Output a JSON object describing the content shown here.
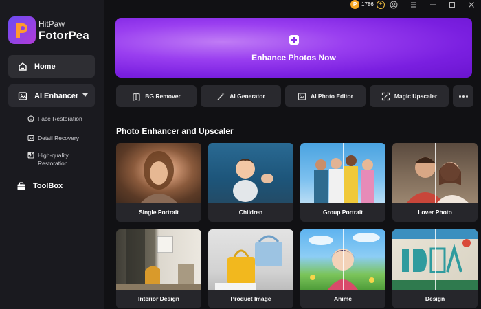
{
  "brand": {
    "small": "HitPaw",
    "big": "FotorPea"
  },
  "sidebar": {
    "home": "Home",
    "ai_enhancer": "AI Enhancer",
    "sub_items": [
      {
        "label": "Face Restoration",
        "icon": "face-icon"
      },
      {
        "label": "Detail Recovery",
        "icon": "detail-icon"
      },
      {
        "label": "High-quality Restoration",
        "icon": "restore-icon"
      }
    ],
    "toolbox": "ToolBox"
  },
  "titlebar": {
    "coins": "1786",
    "add": "+"
  },
  "hero": {
    "label": "Enhance Photos Now"
  },
  "tools": [
    {
      "label": "BG Remover",
      "icon": "bg-remover-icon"
    },
    {
      "label": "AI Generator",
      "icon": "ai-generator-icon"
    },
    {
      "label": "AI Photo Editor",
      "icon": "photo-editor-icon"
    },
    {
      "label": "Magic Upscaler",
      "icon": "upscaler-icon"
    }
  ],
  "section_title": "Photo Enhancer and Upscaler",
  "cards": [
    {
      "label": "Single Portrait"
    },
    {
      "label": "Children"
    },
    {
      "label": "Group Portrait"
    },
    {
      "label": "Lover Photo"
    },
    {
      "label": "Interior Design"
    },
    {
      "label": "Product Image"
    },
    {
      "label": "Anime"
    },
    {
      "label": "Design"
    }
  ],
  "colors": {
    "accent": "#8a2fe6",
    "sidebar_bg": "#1a1a1f",
    "coin": "#f5a623"
  }
}
